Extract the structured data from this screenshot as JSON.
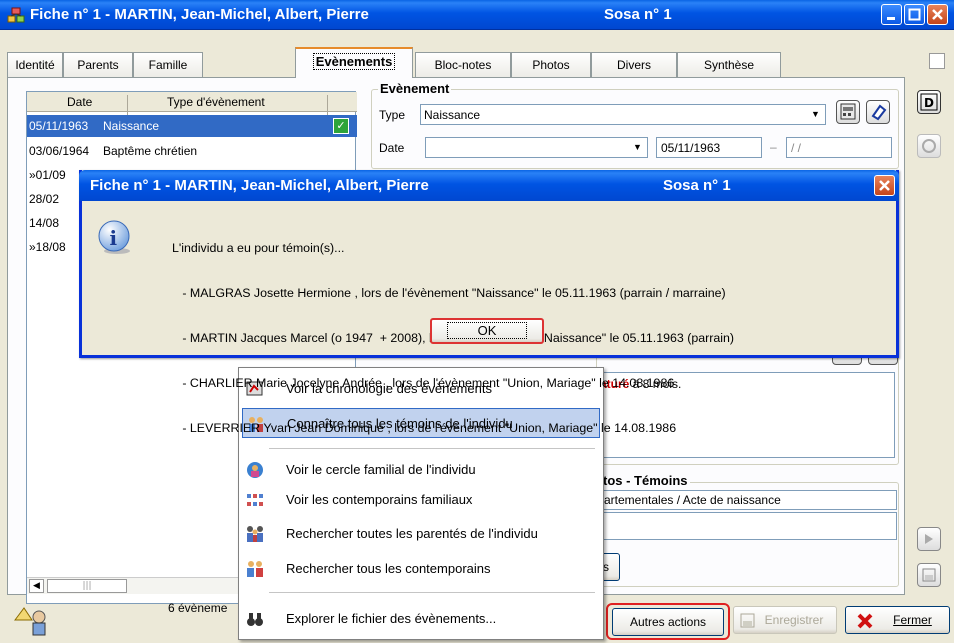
{
  "window": {
    "title_left": "Fiche n° 1   -  MARTIN, Jean-Michel, Albert, Pierre",
    "title_right": "Sosa n° 1"
  },
  "tabs": [
    {
      "label": "Identité"
    },
    {
      "label": "Parents"
    },
    {
      "label": "Famille"
    },
    {
      "label": "Evènements",
      "active": true
    },
    {
      "label": "Bloc-notes"
    },
    {
      "label": "Photos"
    },
    {
      "label": "Divers"
    },
    {
      "label": "Synthèse"
    }
  ],
  "events_list": {
    "col_date": "Date",
    "col_type": "Type d'évènement",
    "rows": [
      {
        "date": "05/11/1963",
        "type": "Naissance",
        "selected": true
      },
      {
        "date": "03/06/1964",
        "type": "Baptême chrétien"
      },
      {
        "date": "»01/09",
        "type": ""
      },
      {
        "date": "28/02",
        "type": ""
      },
      {
        "date": "14/08",
        "type": ""
      },
      {
        "date": "»18/08",
        "type": ""
      }
    ],
    "count_label": "6 évèneme"
  },
  "event_group": {
    "title": "Evènement",
    "type_label": "Type",
    "type_value": "Naissance",
    "date_label": "Date",
    "date_value": "05/11/1963",
    "date_second": "/     /"
  },
  "note_area": {
    "red_word": "aturé",
    "rest": " à 8 mois."
  },
  "sources_group": {
    "title": "tos - Témoins",
    "value": "artementales / Acte de naissance",
    "partial_btn": "s"
  },
  "dialog": {
    "title_left": "Fiche n° 1   -  MARTIN, Jean-Michel, Albert, Pierre",
    "title_right": "Sosa n° 1",
    "intro": "L'individu a eu pour témoin(s)...",
    "lines": [
      "   - MALGRAS Josette Hermione , lors de l'évènement \"Naissance\" le 05.11.1963 (parrain / marraine)",
      "   - MARTIN Jacques Marcel (o 1947  + 2008), lors de l'évènement \"Naissance\" le 05.11.1963 (parrain)",
      "   - CHARLIER Marie Jocelyne Andrée , lors de l'évènement \"Union, Mariage\" le 14.08.1986",
      "   - LEVERRIER Yvan Jean Dominique , lors de l'évènement \"Union, Mariage\" le 14.08.1986"
    ],
    "ok_label": "OK"
  },
  "context_menu": {
    "items": [
      {
        "label": "Voir la chronologie des évènements",
        "icon": "timeline-icon"
      },
      {
        "label": "Connaître tous les témoins de l'individu",
        "icon": "witnesses-icon",
        "highlighted": true
      },
      {
        "label": "Voir le cercle familial de l'individu",
        "icon": "family-circle-icon"
      },
      {
        "label": "Voir les contemporains familiaux",
        "icon": "contemporaries-icon"
      },
      {
        "label": "Rechercher toutes les parentés de l'individu",
        "icon": "relatives-icon"
      },
      {
        "label": "Rechercher tous les contemporains",
        "icon": "search-people-icon"
      },
      {
        "label": "Explorer le fichier des évènements...",
        "icon": "binoculars-icon"
      }
    ]
  },
  "bottom_bar": {
    "other_actions": "Autres actions",
    "save": "Enregistrer",
    "close": "Fermer"
  },
  "colors": {
    "titlebar": "#0054e3",
    "selection": "#316ac5",
    "highlight_red": "#e02020"
  }
}
